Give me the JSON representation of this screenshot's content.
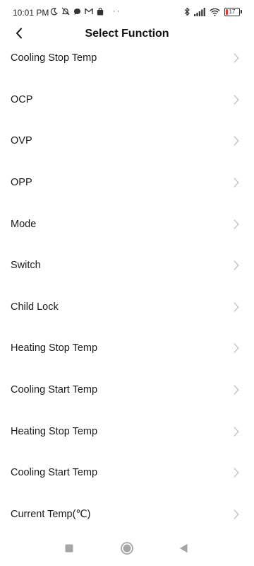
{
  "status_bar": {
    "time": "10:01 PM",
    "left_icons": [
      "moon-icon",
      "notifications-off-icon",
      "chat-bubble-icon",
      "gmail-icon",
      "bag-icon"
    ],
    "overflow_dots": "··",
    "right_icons": [
      "bluetooth-icon",
      "signal-icon",
      "wifi-icon"
    ],
    "battery_level": "17",
    "battery_fraction": 0.17,
    "battery_color": "#e53935"
  },
  "header": {
    "title": "Select Function",
    "back_icon": "chevron-left-icon"
  },
  "functions": [
    {
      "label": "Cooling Stop Temp"
    },
    {
      "label": "OCP"
    },
    {
      "label": "OVP"
    },
    {
      "label": "OPP"
    },
    {
      "label": "Mode"
    },
    {
      "label": "Switch"
    },
    {
      "label": "Child Lock"
    },
    {
      "label": "Heating Stop Temp"
    },
    {
      "label": "Cooling Start Temp"
    },
    {
      "label": "Heating Stop Temp"
    },
    {
      "label": "Cooling Start Temp"
    },
    {
      "label": "Current Temp(℃)"
    }
  ],
  "nav_bar": {
    "buttons": [
      "square-recents-icon",
      "circle-home-icon",
      "triangle-back-icon"
    ],
    "icon_color": "#a6a6a6"
  },
  "colors": {
    "chevron": "#c4c4c4",
    "text": "#1a1a1a"
  }
}
